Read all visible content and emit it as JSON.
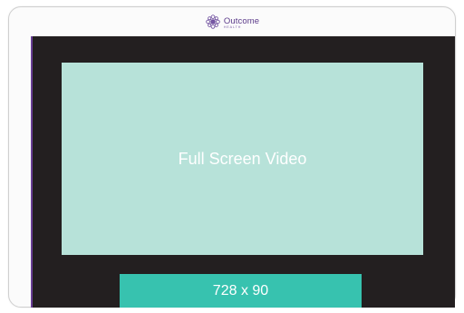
{
  "header": {
    "brand_name": "Outcome",
    "brand_sub": "HEALTH",
    "logo_icon": "flower-logo-icon"
  },
  "screen": {
    "video_label": "Full Screen Video",
    "banner_label": "728 x 90"
  },
  "colors": {
    "brand": "#5b3a8a",
    "screen_bg": "#231f20",
    "video_bg": "#b7e2d9",
    "banner_bg": "#37c2af"
  }
}
